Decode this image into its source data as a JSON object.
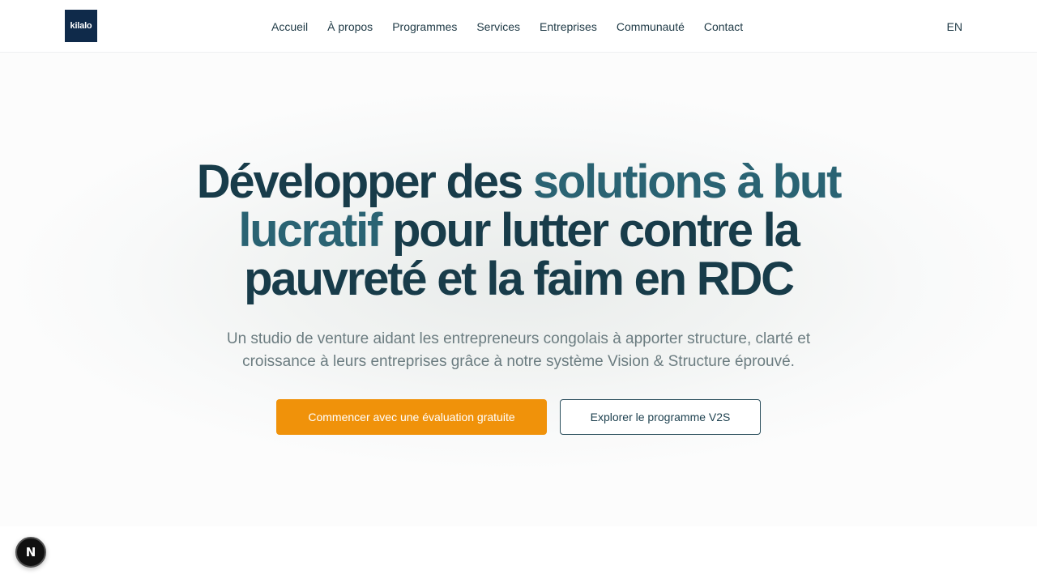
{
  "header": {
    "logo_text": "kilalo",
    "nav": [
      {
        "label": "Accueil"
      },
      {
        "label": "À propos"
      },
      {
        "label": "Programmes"
      },
      {
        "label": "Services"
      },
      {
        "label": "Entreprises"
      },
      {
        "label": "Communauté"
      },
      {
        "label": "Contact"
      }
    ],
    "language_toggle": "EN"
  },
  "hero": {
    "headline": {
      "part1": "Développer des ",
      "accent": "solutions à but lucratif",
      "part2": " pour lutter contre la pauvreté et la faim en RDC"
    },
    "subtitle": "Un studio de venture aidant les entrepreneurs congolais à apporter structure, clarté et croissance à leurs entreprises grâce à notre système Vision & Structure éprouvé.",
    "primary_cta": "Commencer avec une évaluation gratuite",
    "secondary_cta": "Explorer le programme V2S"
  },
  "dev_badge": {
    "letter": "N",
    "icon": "nextjs-icon"
  },
  "colors": {
    "brand_dark": "#183c4a",
    "brand_accent": "#2a6373",
    "cta_orange": "#f0920a",
    "logo_bg": "#0f2a4a"
  }
}
